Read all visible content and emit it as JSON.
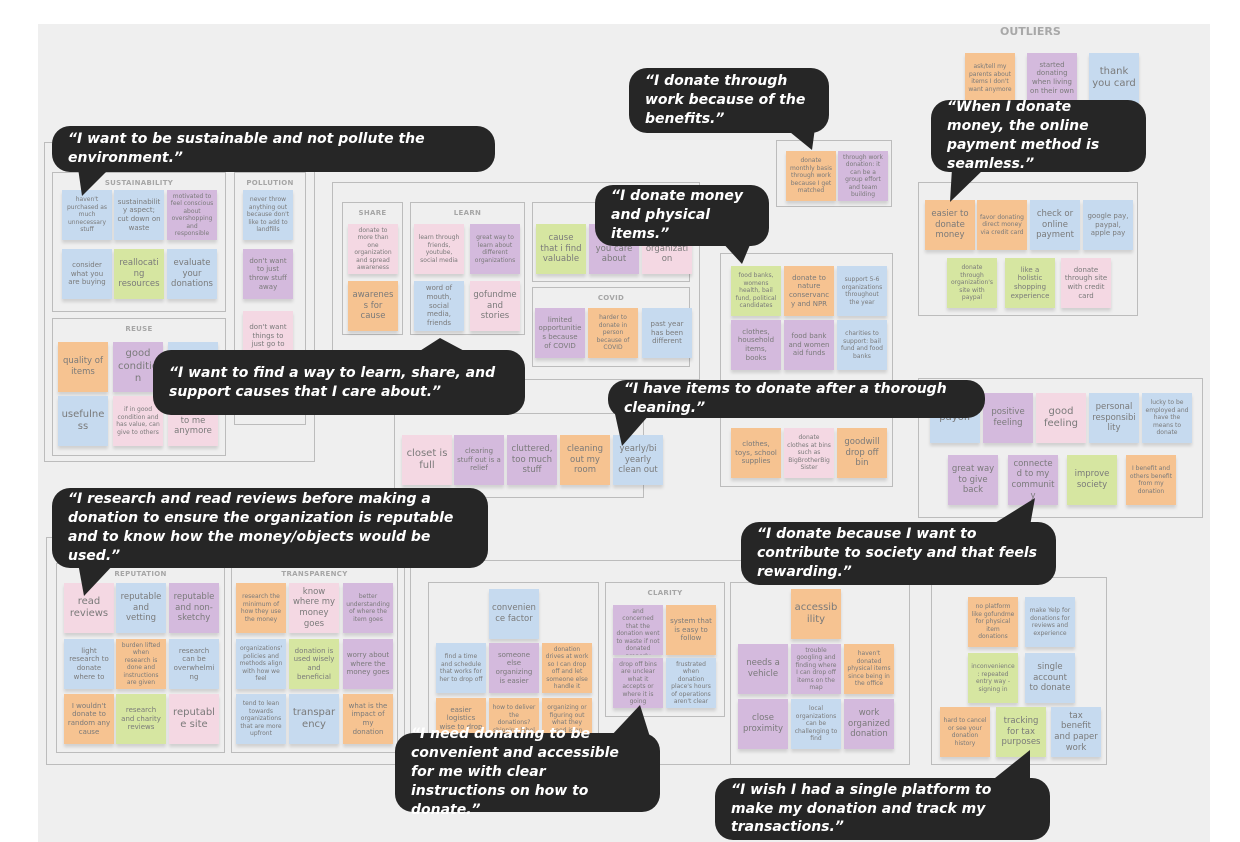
{
  "colors": {
    "blue": "#c6daef",
    "purple": "#d4badd",
    "orange": "#f6c391",
    "green": "#d6e6a1",
    "pink": "#f4d8e3",
    "bubble": "#262626",
    "canvas": "#efefef"
  },
  "outliers_title": "OUTLIERS",
  "groups": [
    {
      "id": "sustainability",
      "title": "SUSTAINABILITY",
      "notes": [
        {
          "text": "haven't purchased as much unnecessary stuff",
          "color": "blue"
        },
        {
          "text": "sustainability aspect; cut down on waste",
          "color": "blue"
        },
        {
          "text": "motivated to feel conscious about overshopping and responsible",
          "color": "purple"
        },
        {
          "text": "consider what you are buying",
          "color": "blue"
        },
        {
          "text": "reallocating resources",
          "color": "green"
        },
        {
          "text": "evaluate your donations",
          "color": "blue"
        }
      ]
    },
    {
      "id": "pollution",
      "title": "POLLUTION",
      "notes": [
        {
          "text": "never throw anything out because don't like to add to landfills",
          "color": "blue"
        },
        {
          "text": "don't want to just throw stuff away",
          "color": "purple"
        },
        {
          "text": "don't want things to just go to",
          "color": "pink"
        }
      ]
    },
    {
      "id": "reuse",
      "title": "REUSE",
      "notes": [
        {
          "text": "quality of items",
          "color": "orange"
        },
        {
          "text": "good condition",
          "color": "purple"
        },
        {
          "text": "",
          "color": "blue"
        },
        {
          "text": "usefulness",
          "color": "blue"
        },
        {
          "text": "if in good condition and has value, can give to others",
          "color": "pink"
        },
        {
          "text": "spark joy to me anymore",
          "color": "pink"
        }
      ]
    },
    {
      "id": "share",
      "title": "SHARE",
      "notes": [
        {
          "text": "donate to more than one organization and spread awareness",
          "color": "pink"
        },
        {
          "text": "awareness for cause",
          "color": "orange"
        }
      ]
    },
    {
      "id": "learn",
      "title": "LEARN",
      "notes": [
        {
          "text": "learn through friends, youtube, social media",
          "color": "pink"
        },
        {
          "text": "great way to learn about different organizations",
          "color": "purple"
        },
        {
          "text": "word of mouth, social media, friends",
          "color": "blue"
        },
        {
          "text": "gofundme and stories",
          "color": "pink"
        }
      ]
    },
    {
      "id": "cause",
      "title": "",
      "notes": [
        {
          "text": "cause that i find valuable",
          "color": "green"
        },
        {
          "text": "causes you care about",
          "color": "purple"
        },
        {
          "text": "with the organization",
          "color": "pink"
        }
      ]
    },
    {
      "id": "covid",
      "title": "COVID",
      "notes": [
        {
          "text": "limited opportunities because of COVID",
          "color": "purple"
        },
        {
          "text": "harder to donate in person because of COVID",
          "color": "orange"
        },
        {
          "text": "past year has been different",
          "color": "blue"
        }
      ]
    },
    {
      "id": "work",
      "title": "",
      "notes": [
        {
          "text": "donate monthly basis through work because I get matched",
          "color": "orange"
        },
        {
          "text": "through work donation: it can be a group effort and team building",
          "color": "purple"
        }
      ]
    },
    {
      "id": "money-items",
      "title": "",
      "notes": [
        {
          "text": "food banks, womens health, bail fund, political candidates",
          "color": "green"
        },
        {
          "text": "donate to nature conservancy and NPR",
          "color": "orange"
        },
        {
          "text": "support 5-6 organizations throughout the year",
          "color": "blue"
        },
        {
          "text": "clothes, household items, books",
          "color": "purple"
        },
        {
          "text": "food bank and women aid funds",
          "color": "purple"
        },
        {
          "text": "charities to support: bail fund and food banks",
          "color": "blue"
        },
        {
          "text": "clothes, toys, school supplies",
          "color": "orange"
        },
        {
          "text": "donate clothes at bins such as BigBrotherBigSister",
          "color": "pink"
        },
        {
          "text": "goodwill drop off bin",
          "color": "orange"
        }
      ]
    },
    {
      "id": "cleaning",
      "title": "",
      "notes": [
        {
          "text": "closet is full",
          "color": "pink"
        },
        {
          "text": "clearing stuff out is a relief",
          "color": "purple"
        },
        {
          "text": "cluttered, too much stuff",
          "color": "purple"
        },
        {
          "text": "cleaning out my room",
          "color": "orange"
        },
        {
          "text": "yearly/bi yearly clean out",
          "color": "blue"
        }
      ]
    },
    {
      "id": "outliers",
      "title": "",
      "notes": [
        {
          "text": "ask/tell my parents about items I don't want anymore",
          "color": "orange"
        },
        {
          "text": "started donating when living on their own",
          "color": "purple"
        },
        {
          "text": "thank you card",
          "color": "blue"
        }
      ]
    },
    {
      "id": "payment",
      "title": "",
      "notes": [
        {
          "text": "easier to donate money",
          "color": "orange"
        },
        {
          "text": "favor donating direct money via credit card",
          "color": "orange"
        },
        {
          "text": "check or online payment",
          "color": "blue"
        },
        {
          "text": "google pay, paypal, apple pay",
          "color": "blue"
        },
        {
          "text": "donate through organization's site with paypal",
          "color": "green"
        },
        {
          "text": "like a holistic shopping experience",
          "color": "green"
        },
        {
          "text": "donate through site with credit card",
          "color": "pink"
        }
      ]
    },
    {
      "id": "feeling",
      "title": "",
      "notes": [
        {
          "text": "payoff",
          "color": "blue"
        },
        {
          "text": "positive feeling",
          "color": "purple"
        },
        {
          "text": "good feeling",
          "color": "pink"
        },
        {
          "text": "personal responsibility",
          "color": "blue"
        },
        {
          "text": "lucky to be employed and have the means to donate",
          "color": "blue"
        },
        {
          "text": "great way to give back",
          "color": "purple"
        },
        {
          "text": "connected to my community",
          "color": "purple"
        },
        {
          "text": "improve society",
          "color": "green"
        },
        {
          "text": "I benefit and others benefit from my donation",
          "color": "orange"
        }
      ]
    },
    {
      "id": "reputation",
      "title": "REPUTATION",
      "notes": [
        {
          "text": "read reviews",
          "color": "pink"
        },
        {
          "text": "reputable and vetting",
          "color": "blue"
        },
        {
          "text": "reputable and non-sketchy",
          "color": "purple"
        },
        {
          "text": "light research to donate where to",
          "color": "blue"
        },
        {
          "text": "burden lifted when research is done and instructions are given",
          "color": "orange"
        },
        {
          "text": "research can be overwhelming",
          "color": "blue"
        },
        {
          "text": "I wouldn't donate to random any cause",
          "color": "orange"
        },
        {
          "text": "research and charity reviews",
          "color": "green"
        },
        {
          "text": "reputable site",
          "color": "pink"
        }
      ]
    },
    {
      "id": "transparency",
      "title": "TRANSPARENCY",
      "notes": [
        {
          "text": "research the minimum of how they use the money",
          "color": "orange"
        },
        {
          "text": "know where my money goes",
          "color": "pink"
        },
        {
          "text": "better understanding of where the item goes",
          "color": "purple"
        },
        {
          "text": "organizations' policies and methods align with how we feel",
          "color": "blue"
        },
        {
          "text": "donation is used wisely and beneficial",
          "color": "green"
        },
        {
          "text": "worry about where the money goes",
          "color": "purple"
        },
        {
          "text": "tend to lean towards organizations that are more upfront",
          "color": "blue"
        },
        {
          "text": "transparency",
          "color": "blue"
        },
        {
          "text": "what is the impact of my donation",
          "color": "orange"
        }
      ]
    },
    {
      "id": "convenience",
      "title": "",
      "notes": [
        {
          "text": "convenience factor",
          "color": "blue"
        },
        {
          "text": "find a time and schedule that works for her to drop off",
          "color": "blue"
        },
        {
          "text": "someone else organizing is easier",
          "color": "purple"
        },
        {
          "text": "donation drives at work so I can drop off and let someone else handle it",
          "color": "orange"
        },
        {
          "text": "easier logistics wise to drop it off",
          "color": "orange"
        },
        {
          "text": "how to deliver the donations? shipping label or drop off",
          "color": "orange"
        },
        {
          "text": "organizing or figuring out what they need is an extra layer",
          "color": "orange"
        }
      ]
    },
    {
      "id": "clarity",
      "title": "CLARITY",
      "notes": [
        {
          "text": "feel worried and concerned that the donation went to waste if not donated properly",
          "color": "purple"
        },
        {
          "text": "system that is easy to follow",
          "color": "orange"
        },
        {
          "text": "drop off bins are unclear what it accepts or where it is going",
          "color": "purple"
        },
        {
          "text": "frustrated when donation place's hours of operations aren't clear",
          "color": "blue"
        }
      ]
    },
    {
      "id": "accessibility",
      "title": "",
      "notes": [
        {
          "text": "accessibility",
          "color": "orange"
        },
        {
          "text": "needs a vehicle",
          "color": "purple"
        },
        {
          "text": "trouble googling and finding where I can drop off items on the map",
          "color": "purple"
        },
        {
          "text": "haven't donated physical items since being in the office",
          "color": "orange"
        },
        {
          "text": "close proximity",
          "color": "purple"
        },
        {
          "text": "local organizations can be challenging to find",
          "color": "blue"
        },
        {
          "text": "work organized donation",
          "color": "purple"
        }
      ]
    },
    {
      "id": "platform",
      "title": "",
      "notes": [
        {
          "text": "no platform like gofundme for physical item donations",
          "color": "orange"
        },
        {
          "text": "make Yelp for donations for reviews and experience",
          "color": "blue"
        },
        {
          "text": "inconvenience: repeated entry way - signing in",
          "color": "green"
        },
        {
          "text": "single account to donate",
          "color": "blue"
        },
        {
          "text": "hard to cancel or see your donation history",
          "color": "orange"
        },
        {
          "text": "tracking for tax purposes",
          "color": "green"
        },
        {
          "text": "tax benefit and paper work",
          "color": "blue"
        }
      ]
    }
  ],
  "quotes": [
    "“I want to be sustainable and not pollute the environment.”",
    "“I donate through work because of the benefits.”",
    "“I donate money and physical items.”",
    "“When I donate money, the online payment method is seamless.”",
    "“I want to find a way to learn, share, and support causes that I care about.”",
    "“I have items to donate after a thorough cleaning.”",
    "“I research and read reviews before making a donation to ensure the organization is reputable and to know how the money/objects would be used.”",
    "“I donate because I want to contribute to society and that feels rewarding.”",
    "“I need donating to be convenient and accessible for me with clear instructions on how to donate.”",
    "“I wish I had a single platform to make my donation and track my transactions.”"
  ]
}
